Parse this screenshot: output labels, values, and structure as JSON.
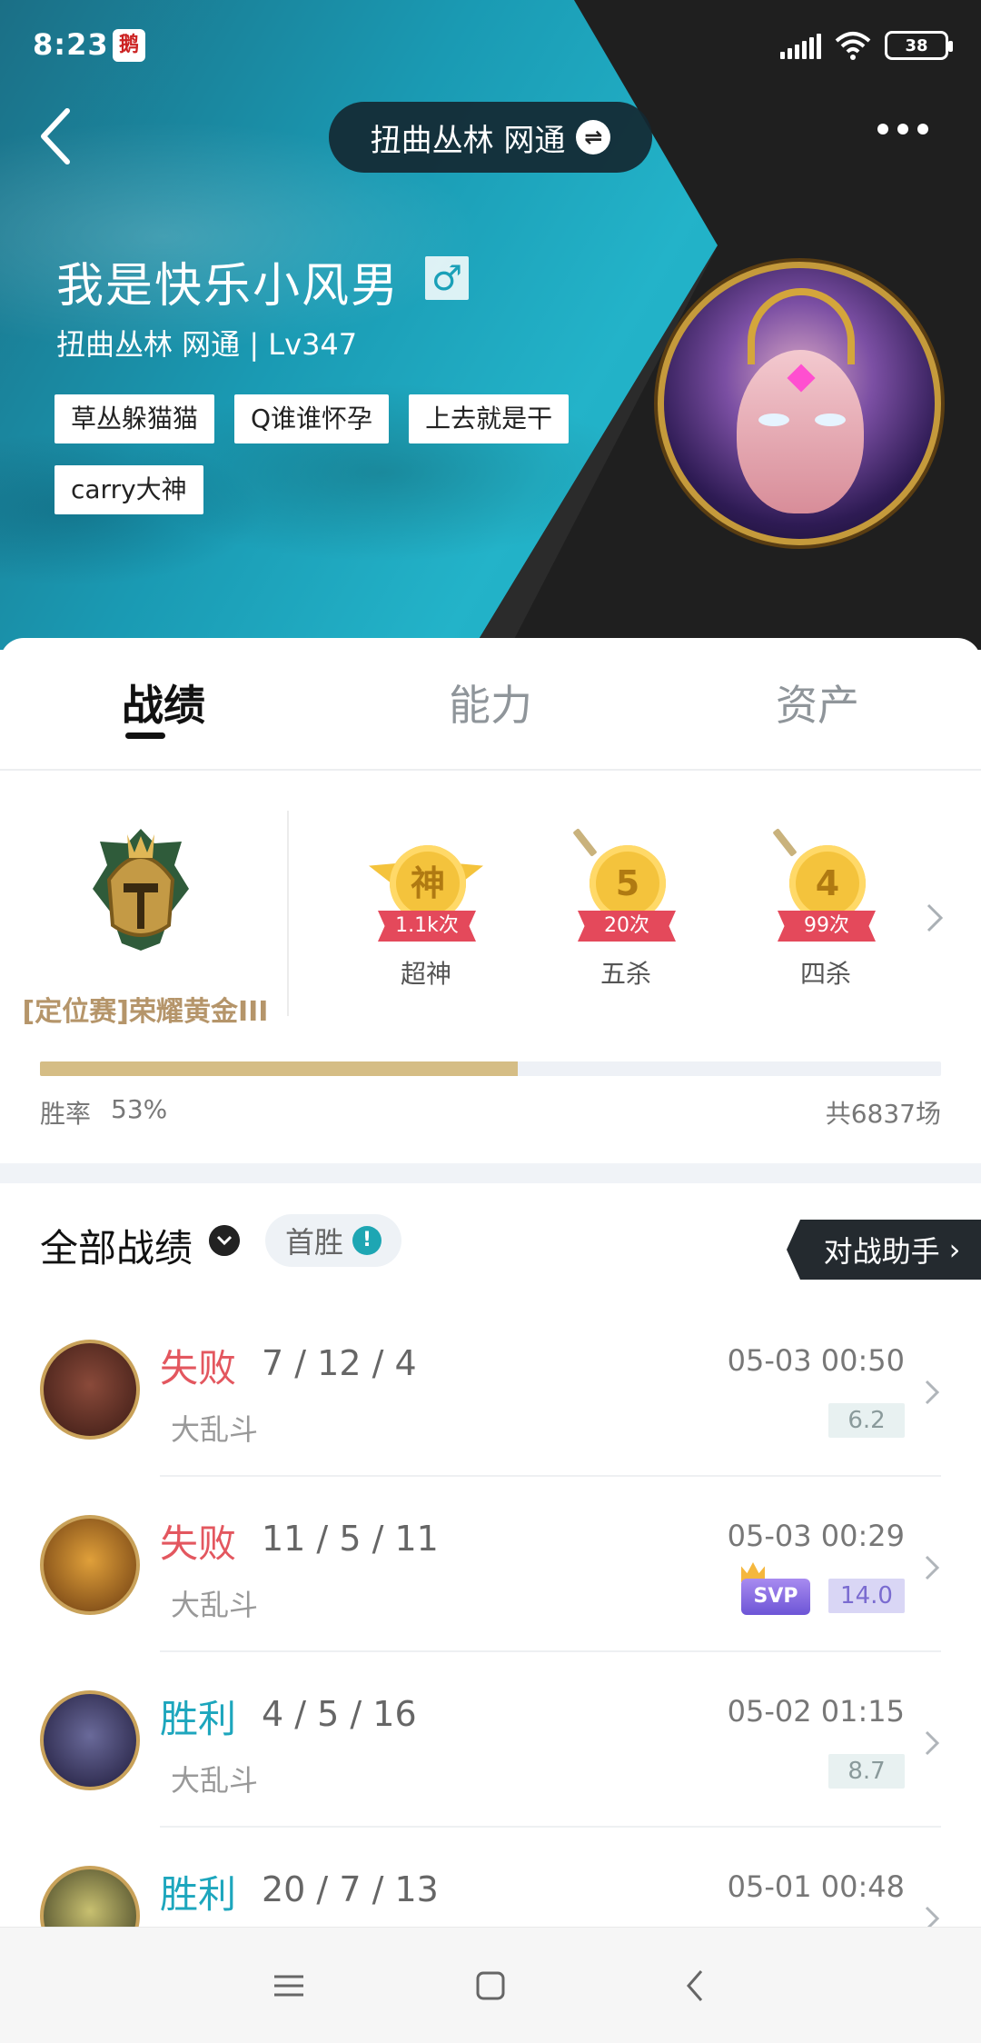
{
  "status_bar": {
    "time": "8:23",
    "app_icon": "tencent-app-icon",
    "battery": "38"
  },
  "header": {
    "server": "扭曲丛林 网通",
    "player_name": "我是快乐小风男",
    "gender_icon": "male-icon",
    "subline": "扭曲丛林 网通 | Lv347",
    "tags": [
      "草丛躲猫猫",
      "Q谁谁怀孕",
      "上去就是干",
      "carry大神"
    ]
  },
  "tabs": [
    {
      "label": "战绩",
      "active": true
    },
    {
      "label": "能力",
      "active": false
    },
    {
      "label": "资产",
      "active": false
    }
  ],
  "rank": {
    "label": "[定位赛]荣耀黄金III"
  },
  "achievements": [
    {
      "glyph": "神",
      "count": "1.1k次",
      "label": "超神"
    },
    {
      "glyph": "5",
      "count": "20次",
      "label": "五杀"
    },
    {
      "glyph": "4",
      "count": "99次",
      "label": "四杀"
    }
  ],
  "stats": {
    "winrate_label": "胜率",
    "winrate_value": "53%",
    "winrate_fraction": 0.53,
    "total_games": "共6837场"
  },
  "filter": {
    "title": "全部战绩",
    "first_win": "首胜",
    "assistant": "对战助手"
  },
  "records": [
    {
      "result": "失败",
      "outcome": "lose",
      "kda": "7 / 12 / 4",
      "mode": "大乱斗",
      "time": "05-03 00:50",
      "score": "6.2",
      "svp": false,
      "svp_label": ""
    },
    {
      "result": "失败",
      "outcome": "lose",
      "kda": "11 / 5 / 11",
      "mode": "大乱斗",
      "time": "05-03 00:29",
      "score": "14.0",
      "svp": true,
      "svp_label": "SVP"
    },
    {
      "result": "胜利",
      "outcome": "win",
      "kda": "4 / 5 / 16",
      "mode": "大乱斗",
      "time": "05-02 01:15",
      "score": "8.7",
      "svp": false,
      "svp_label": ""
    },
    {
      "result": "胜利",
      "outcome": "win",
      "kda": "20 / 7 / 13",
      "mode": "",
      "time": "05-01 00:48",
      "score": "",
      "svp": false,
      "svp_label": ""
    }
  ],
  "colors": {
    "accent": "#1da6bd",
    "lose": "#e3575f",
    "gold": "#b5956a"
  }
}
